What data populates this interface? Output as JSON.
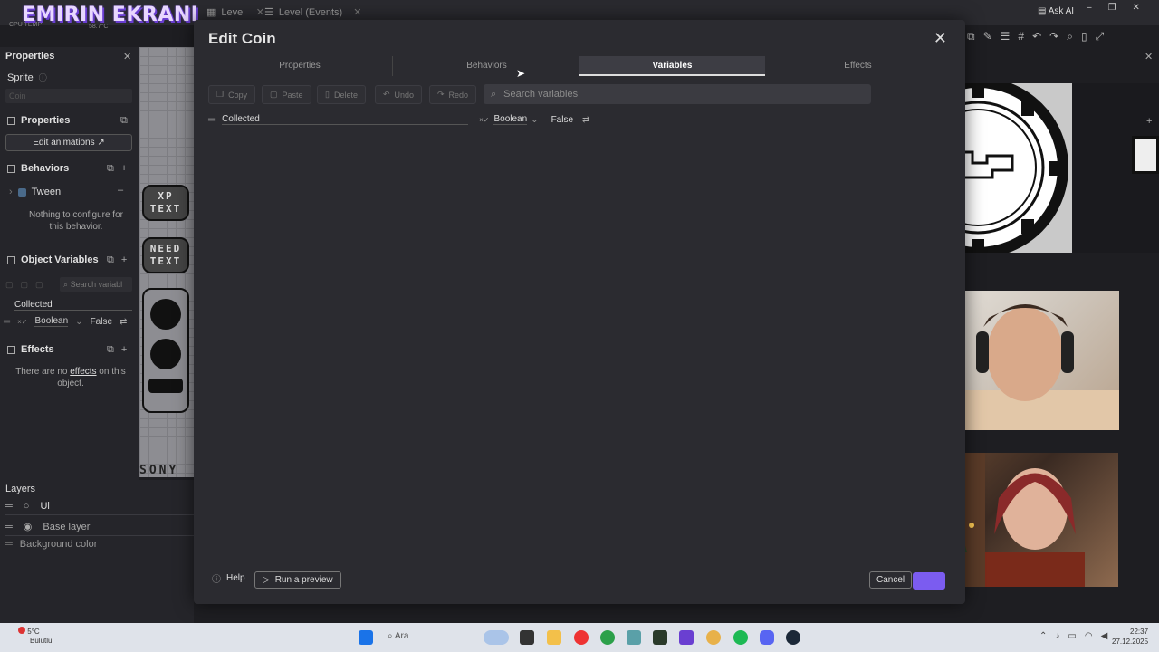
{
  "topbar": {
    "stream_title": "EMIRIN EKRANI",
    "cpu_label": "CPU TEMP",
    "cpu_value": "58.7°C",
    "tabs": [
      {
        "label": "Level"
      },
      {
        "label": "Level (Events)"
      }
    ],
    "ask_ai": "Ask AI"
  },
  "left_panel": {
    "header": "Properties",
    "object_type": "Sprite",
    "name_placeholder": "Coin",
    "properties_section": "Properties",
    "edit_animations": "Edit animations",
    "behaviors_section": "Behaviors",
    "behavior_name": "Tween",
    "behavior_note": "Nothing to configure for this behavior.",
    "object_variables_section": "Object Variables",
    "search_placeholder": "Search variabl",
    "variable_name": "Collected",
    "variable_type": "Boolean",
    "variable_value": "False",
    "effects_section": "Effects",
    "effects_note_1": "There are no ",
    "effects_link": "effects",
    "effects_note_2": " on this object."
  },
  "canvas_sprites": [
    {
      "label": "XP TEXT"
    },
    {
      "label": "NEED TEXT"
    }
  ],
  "canvas_footer": "SONY",
  "layers": {
    "header": "Layers",
    "items": [
      {
        "label": "Ui"
      },
      {
        "label": "Base layer"
      }
    ],
    "background": "Background color"
  },
  "dialog": {
    "title": "Edit Coin",
    "tabs": [
      {
        "label": "Properties"
      },
      {
        "label": "Behaviors"
      },
      {
        "label": "Variables"
      },
      {
        "label": "Effects"
      }
    ],
    "active_tab": "Variables",
    "toolbar": {
      "copy": "Copy",
      "paste": "Paste",
      "delete": "Delete",
      "undo": "Undo",
      "redo": "Redo"
    },
    "search_placeholder": "Search variables",
    "variable": {
      "name": "Collected",
      "type": "Boolean",
      "value": "False"
    },
    "footer": {
      "help": "Help",
      "preview": "Run a preview",
      "cancel": "Cancel"
    }
  },
  "taskbar": {
    "weather_temp": "5°C",
    "weather_desc": "Bulutlu",
    "search": "Ara",
    "time": "22:37",
    "date": "27.12.2025"
  },
  "colors": {
    "accent": "#7b5cf0",
    "dialog_bg": "#2b2b30",
    "panel_bg": "#25252a"
  }
}
